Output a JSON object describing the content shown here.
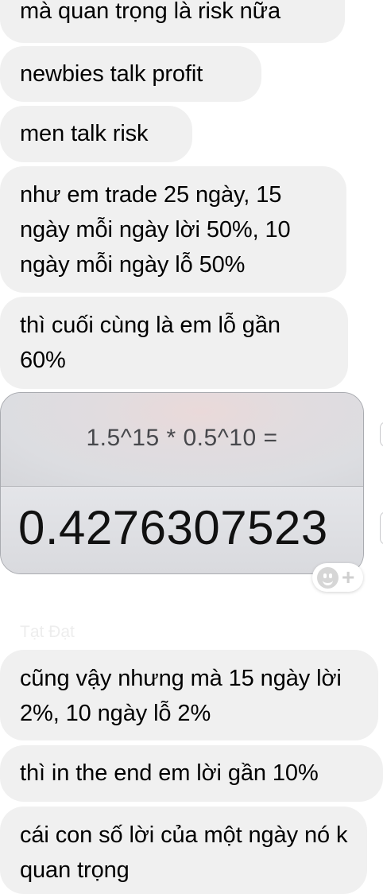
{
  "messages": [
    {
      "text": "mà quan trọng là risk nữa"
    },
    {
      "text": "newbies talk profit"
    },
    {
      "text": "men talk risk"
    },
    {
      "text": "như em trade 25 ngày, 15 ngày mỗi ngày lời 50%, 10 ngày mỗi ngày lỗ 50%"
    },
    {
      "text": "thì cuối cùng là em lỗ gần 60%"
    }
  ],
  "calculator_image": {
    "expression": "1.5^15 * 0.5^10 =",
    "result": "0.4276307523"
  },
  "reaction_button": {
    "icon": "smiley-face-icon",
    "plus": "+"
  },
  "sender_name": "Tạt Đạt",
  "messages_after": [
    {
      "text": "cũng vậy nhưng mà 15 ngày lời 2%, 10 ngày lỗ 2%"
    },
    {
      "text": "thì in the end em lời gần 10%"
    },
    {
      "text": "cái con số lời của một ngày nó k quan trọng"
    }
  ]
}
